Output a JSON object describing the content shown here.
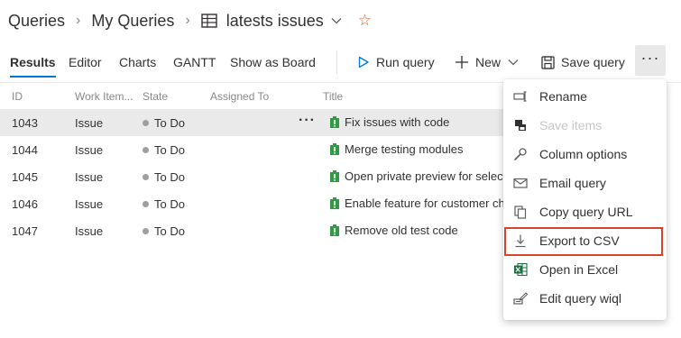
{
  "breadcrumb": {
    "root": "Queries",
    "folder": "My Queries",
    "query": "latests issues",
    "star_icon": "star-outline-icon"
  },
  "toolbar": {
    "tabs": [
      "Results",
      "Editor",
      "Charts",
      "GANTT",
      "Show as Board"
    ],
    "active_tab": "Results",
    "run_query": "Run query",
    "new": "New",
    "save_query": "Save query",
    "more": "···"
  },
  "grid": {
    "columns": [
      "ID",
      "Work Item...",
      "State",
      "Assigned To",
      "Title"
    ],
    "rows": [
      {
        "id": "1043",
        "type": "Issue",
        "state": "To Do",
        "assigned": "",
        "title": "Fix issues with code"
      },
      {
        "id": "1044",
        "type": "Issue",
        "state": "To Do",
        "assigned": "",
        "title": "Merge testing modules"
      },
      {
        "id": "1045",
        "type": "Issue",
        "state": "To Do",
        "assigned": "",
        "title": "Open private preview for select"
      },
      {
        "id": "1046",
        "type": "Issue",
        "state": "To Do",
        "assigned": "",
        "title": "Enable feature for customer ch"
      },
      {
        "id": "1047",
        "type": "Issue",
        "state": "To Do",
        "assigned": "",
        "title": "Remove old test code"
      }
    ],
    "row_more": "···"
  },
  "menu": {
    "items": [
      {
        "label": "Rename",
        "icon": "rename-icon",
        "enabled": true
      },
      {
        "label": "Save items",
        "icon": "save-items-icon",
        "enabled": false
      },
      {
        "label": "Column options",
        "icon": "wrench-icon",
        "enabled": true
      },
      {
        "label": "Email query",
        "icon": "mail-icon",
        "enabled": true
      },
      {
        "label": "Copy query URL",
        "icon": "copy-icon",
        "enabled": true
      },
      {
        "label": "Export to CSV",
        "icon": "download-icon",
        "enabled": true,
        "highlighted": true
      },
      {
        "label": "Open in Excel",
        "icon": "excel-icon",
        "enabled": true
      },
      {
        "label": "Edit query wiql",
        "icon": "edit-wiql-icon",
        "enabled": true
      }
    ]
  },
  "colors": {
    "accent": "#0078d4",
    "highlight_border": "#d9432c",
    "issue_icon": "#339947",
    "star": "#e05a2b",
    "excel": "#1d6f42"
  }
}
